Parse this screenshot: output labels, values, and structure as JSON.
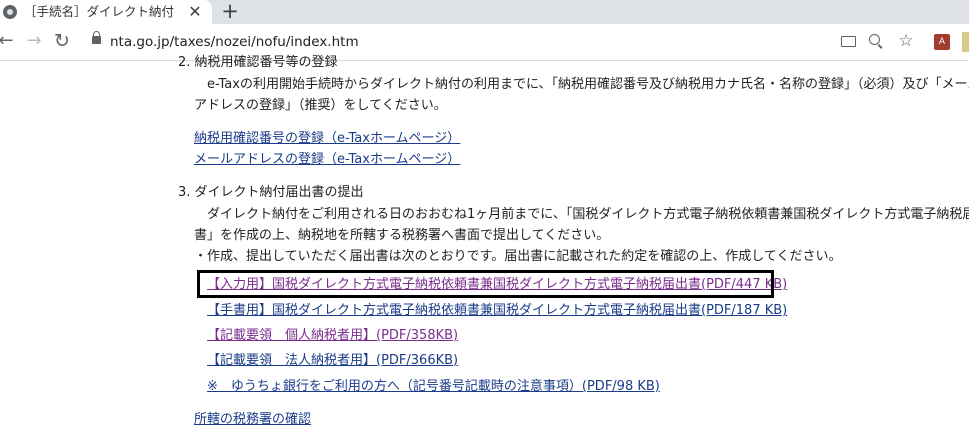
{
  "browser": {
    "tab_title": "［手続名］ダイレクト納付の手続",
    "tab_close": "✕",
    "new_tab": "+",
    "back_icon": "←",
    "forward_icon": "→",
    "reload_icon": "↻",
    "url": "nta.go.jp/taxes/nozei/nofu/index.htm",
    "star_icon": "☆",
    "pdf_icon": "A"
  },
  "page": {
    "section2": {
      "heading": "2. 納税用確認番号等の登録",
      "para_line1": "e-Taxの利用開始手続時からダイレクト納付の利用までに、「納税用確認番号及び納税用カナ氏名・名称の登録」（必須）及び「メール",
      "para_line2": "アドレスの登録」（推奨）をしてください。",
      "link1": "納税用確認番号の登録（e-Taxホームページ）",
      "link2": "メールアドレスの登録（e-Taxホームページ）"
    },
    "section3": {
      "heading": "3. ダイレクト納付届出書の提出",
      "para_line1": "ダイレクト納付をご利用される日のおおむね1ヶ月前までに、「国税ダイレクト方式電子納税依頼書兼国税ダイレクト方式電子納税届出",
      "para_line2": "書」を作成の上、納税地を所轄する税務署へ書面で提出してください。",
      "note": "・作成、提出していただく届出書は次のとおりです。届出書に記載された約定を確認の上、作成してください。",
      "links": [
        "【入力用】国税ダイレクト方式電子納税依頼書兼国税ダイレクト方式電子納税届出書(PDF/447 KB)",
        "【手書用】国税ダイレクト方式電子納税依頼書兼国税ダイレクト方式電子納税届出書(PDF/187 KB)",
        "【記載要領　個人納税者用】(PDF/358KB)",
        "【記載要領　法人納税者用】(PDF/366KB)",
        "※　ゆうちょ銀行をご利用の方へ（記号番号記載時の注意事項）(PDF/98 KB)"
      ],
      "office_link": "所轄の税務署の確認"
    }
  },
  "colors": {
    "link": "#1a3c8a",
    "visited_link": "#7b2d8e",
    "highlight_border": "#000000"
  }
}
